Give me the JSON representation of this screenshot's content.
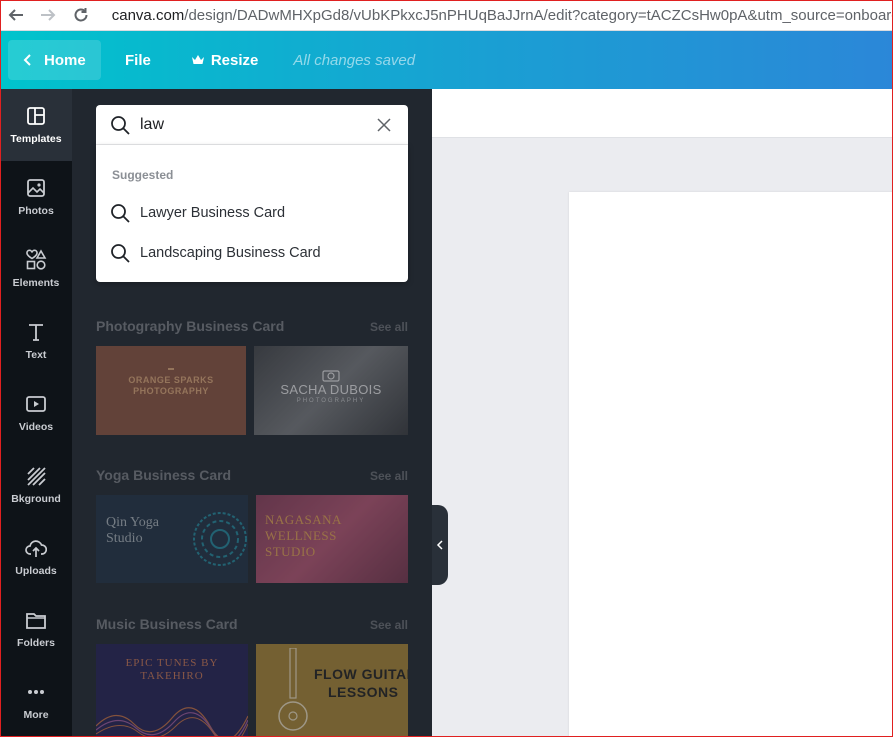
{
  "browser": {
    "url_host": "canva.com",
    "url_path": "/design/DADwMHXpGd8/vUbKPkxcJ5nPHUqBaJJrnA/edit?category=tACZCsHw0pA&utm_source=onboarding"
  },
  "topbar": {
    "home_label": "Home",
    "file_label": "File",
    "resize_label": "Resize",
    "status": "All changes saved"
  },
  "rail": {
    "items": [
      {
        "label": "Templates",
        "icon": "templates-icon"
      },
      {
        "label": "Photos",
        "icon": "photos-icon"
      },
      {
        "label": "Elements",
        "icon": "elements-icon"
      },
      {
        "label": "Text",
        "icon": "text-icon"
      },
      {
        "label": "Videos",
        "icon": "videos-icon"
      },
      {
        "label": "Bkground",
        "icon": "background-icon"
      },
      {
        "label": "Uploads",
        "icon": "uploads-icon"
      },
      {
        "label": "Folders",
        "icon": "folders-icon"
      },
      {
        "label": "More",
        "icon": "more-icon"
      }
    ]
  },
  "search": {
    "value": "law",
    "suggested_label": "Suggested",
    "suggestions": [
      "Lawyer Business Card",
      "Landscaping Business Card"
    ]
  },
  "sections": [
    {
      "title": "Photography Business Card",
      "see_all": "See all",
      "thumbs": [
        {
          "line1": "ORANGE SPARKS",
          "line2": "PHOTOGRAPHY",
          "line3": "",
          "color": "#8d5a49"
        },
        {
          "line1": "SACHA DUBOIS",
          "line2": "PHOTOGRAPHY",
          "line3": "",
          "color": "#5d6066"
        }
      ]
    },
    {
      "title": "Yoga Business Card",
      "see_all": "See all",
      "thumbs": [
        {
          "line1": "Qin Yoga",
          "line2": "Studio",
          "line3": "",
          "color": "#283a4d"
        },
        {
          "line1": "NAGASANA",
          "line2": "WELLNESS",
          "line3": "STUDIO",
          "color": "#8d4763"
        }
      ]
    },
    {
      "title": "Music Business Card",
      "see_all": "See all",
      "thumbs": [
        {
          "line1": "EPIC TUNES BY",
          "line2": "TAKEHIRO",
          "line3": "",
          "color": "#2c2a5c"
        },
        {
          "line1": "FLOW GUITAR",
          "line2": "LESSONS",
          "line3": "",
          "color": "#a8883e"
        }
      ]
    }
  ]
}
